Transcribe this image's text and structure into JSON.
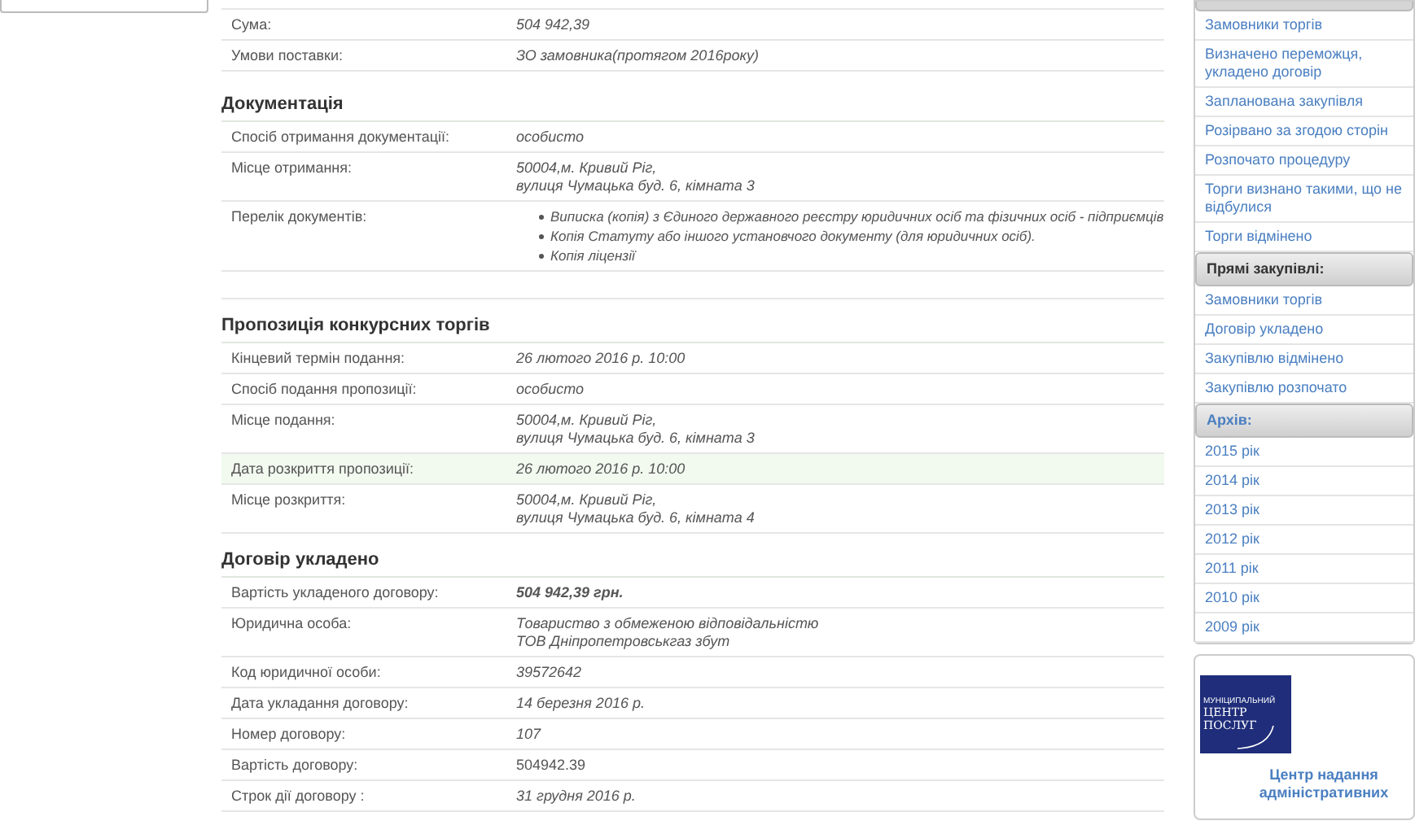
{
  "top_rows": [
    {
      "label": "Сума:",
      "kind": "text",
      "lines": [
        "504 942,39"
      ],
      "highlighted": false,
      "bold": false
    },
    {
      "label": "Умови поставки:",
      "kind": "text",
      "lines": [
        "ЗО замовника(протягом 2016року)"
      ],
      "highlighted": false,
      "bold": false
    }
  ],
  "sections": [
    {
      "title": "Документація",
      "rows": [
        {
          "label": "Спосіб отримання документації:",
          "kind": "text",
          "lines": [
            "особисто"
          ],
          "highlighted": false,
          "bold": false
        },
        {
          "label": "Місце отримання:",
          "kind": "text",
          "lines": [
            "50004,м. Кривий Ріг,",
            "вулиця Чумацька буд. 6, кімната 3"
          ],
          "highlighted": false,
          "bold": false
        },
        {
          "label": "Перелік документів:",
          "kind": "list",
          "lines": [
            "Виписка (копія) з Єдиного державного реєстру юридичних осіб та фізичних осіб - підприємців",
            "Копія Статуту або іншого установчого документу (для юридичних осіб).",
            "Копія ліцензії"
          ],
          "highlighted": false,
          "bold": false
        }
      ]
    },
    {
      "title": "Пропозиція конкурсних торгів",
      "rows": [
        {
          "label": "Кінцевий термін подання:",
          "kind": "text",
          "lines": [
            "26 лютого 2016 р. 10:00"
          ],
          "highlighted": false,
          "bold": false
        },
        {
          "label": "Спосіб подання пропозиції:",
          "kind": "text",
          "lines": [
            "особисто"
          ],
          "highlighted": false,
          "bold": false
        },
        {
          "label": "Місце подання:",
          "kind": "text",
          "lines": [
            "50004,м. Кривий Ріг,",
            "вулиця Чумацька буд. 6, кімната 3"
          ],
          "highlighted": false,
          "bold": false
        },
        {
          "label": "Дата розкриття пропозиції:",
          "kind": "text",
          "lines": [
            "26 лютого 2016 р. 10:00"
          ],
          "highlighted": true,
          "bold": false
        },
        {
          "label": "Місце розкриття:",
          "kind": "text",
          "lines": [
            "50004,м. Кривий Ріг,",
            "вулиця Чумацька буд. 6, кімната 4"
          ],
          "highlighted": false,
          "bold": false
        }
      ]
    },
    {
      "title": "Договір укладено",
      "rows": [
        {
          "label": "Вартість укладеного договору:",
          "kind": "text",
          "lines": [
            "504 942,39 грн."
          ],
          "highlighted": false,
          "bold": true
        },
        {
          "label": "Юридична особа:",
          "kind": "text",
          "lines": [
            "Товариство з обмеженою відповідальністю",
            "ТОВ Дніпропетровськгаз збут"
          ],
          "highlighted": false,
          "bold": false
        },
        {
          "label": "Код юридичної особи:",
          "kind": "text",
          "lines": [
            "39572642"
          ],
          "highlighted": false,
          "bold": false
        },
        {
          "label": "Дата укладання договору:",
          "kind": "text",
          "lines": [
            "14 березня 2016 р."
          ],
          "highlighted": false,
          "bold": false
        },
        {
          "label": "Номер договору:",
          "kind": "text",
          "lines": [
            "107"
          ],
          "highlighted": false,
          "bold": false
        },
        {
          "label": "Вартість договору:",
          "kind": "plain",
          "lines": [
            "504942.39"
          ],
          "highlighted": false,
          "bold": false
        },
        {
          "label": "Строк дії договору :",
          "kind": "text",
          "lines": [
            "31 грудня 2016 р."
          ],
          "highlighted": false,
          "bold": false
        }
      ]
    }
  ],
  "sidebar": {
    "groups": [
      {
        "items": [
          "Замовники торгів",
          "Визначено переможця, укладено договір",
          "Запланована закупівля",
          "Розірвано за згодою сторін",
          "Розпочато процедуру",
          "Торги визнано такими, що не відбулися",
          "Торги відмінено"
        ]
      },
      {
        "header": "Прямі закупівлі:",
        "active": false,
        "items": [
          "Замовники торгів",
          "Договір укладено",
          "Закупівлю відмінено",
          "Закупівлю розпочато"
        ]
      },
      {
        "header": "Архів:",
        "active": true,
        "items": [
          "2015 рік",
          "2014 рік",
          "2013 рік",
          "2012 рік",
          "2011 рік",
          "2010 рік",
          "2009 рік"
        ]
      }
    ]
  },
  "banner": {
    "logo_lines": [
      "МУНІЦИПАЛЬНИЙ",
      "ЦЕНТР",
      "ПОСЛУГ"
    ],
    "caption": "Центр надання адміністративних"
  }
}
